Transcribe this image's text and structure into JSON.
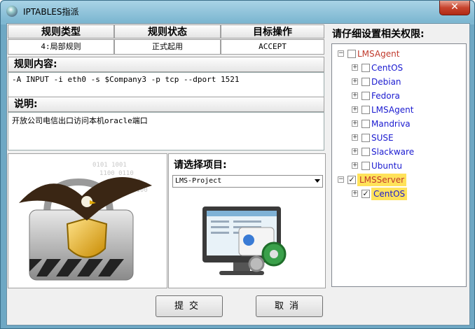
{
  "window": {
    "title": "IPTABLES指派",
    "close_label": "✕"
  },
  "rule_table": {
    "headers": [
      "规则类型",
      "规则状态",
      "目标操作"
    ],
    "values": [
      "4:局部规则",
      "正式起用",
      "ACCEPT"
    ]
  },
  "rule_content": {
    "label": "规则内容:",
    "value": "-A INPUT -i eth0 -s $Company3 -p tcp --dport 1521"
  },
  "description": {
    "label": "说明:",
    "value": "开放公司电信出口访问本机oracle端口"
  },
  "project": {
    "label": "请选择项目:",
    "selected": "LMS-Project"
  },
  "permissions": {
    "label": "请仔细设置相关权限:",
    "tree": [
      {
        "label": "LMSAgent",
        "checked": false,
        "expanded": true,
        "level": 0,
        "color": "#c0392b",
        "highlight": false
      },
      {
        "label": "CentOS",
        "checked": false,
        "level": 1,
        "color": "#1a1ad0",
        "highlight": false
      },
      {
        "label": "Debian",
        "checked": false,
        "level": 1,
        "color": "#1a1ad0",
        "highlight": false
      },
      {
        "label": "Fedora",
        "checked": false,
        "level": 1,
        "color": "#1a1ad0",
        "highlight": false
      },
      {
        "label": "LMSAgent",
        "checked": false,
        "level": 1,
        "color": "#1a1ad0",
        "highlight": false
      },
      {
        "label": "Mandriva",
        "checked": false,
        "level": 1,
        "color": "#1a1ad0",
        "highlight": false
      },
      {
        "label": "SUSE",
        "checked": false,
        "level": 1,
        "color": "#1a1ad0",
        "highlight": false
      },
      {
        "label": "Slackware",
        "checked": false,
        "level": 1,
        "color": "#1a1ad0",
        "highlight": false
      },
      {
        "label": "Ubuntu",
        "checked": false,
        "level": 1,
        "color": "#1a1ad0",
        "highlight": false
      },
      {
        "label": "LMSServer",
        "checked": true,
        "expanded": true,
        "level": 0,
        "color": "#c0392b",
        "highlight": true
      },
      {
        "label": "CentOS",
        "checked": true,
        "level": 1,
        "color": "#1a1ad0",
        "highlight": true
      }
    ]
  },
  "buttons": {
    "submit": "提交",
    "cancel": "取消"
  },
  "colors": {
    "highlight": "#ffe25a",
    "titlebar": "#7db7d1"
  }
}
